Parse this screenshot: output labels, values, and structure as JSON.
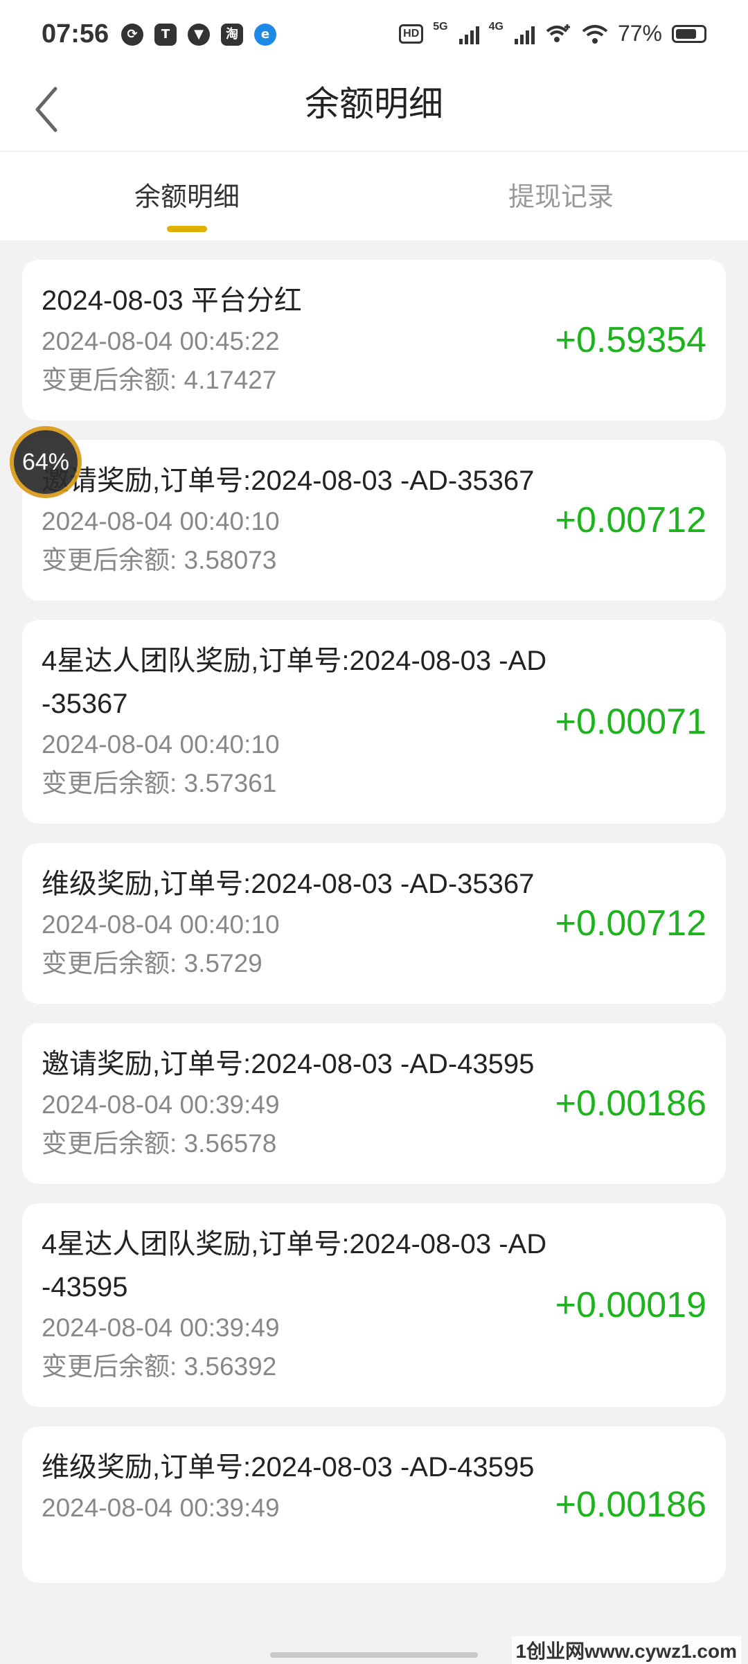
{
  "status_bar": {
    "time": "07:56",
    "app_icons": [
      "sync-icon",
      "shield-t-icon",
      "vpn-shield-icon",
      "taobao-icon",
      "browser-icon"
    ],
    "taobao_glyph": "淘",
    "hd_label": "HD",
    "net1": "5G",
    "net2": "4G",
    "battery_text": "77%",
    "battery_level": 0.77
  },
  "header": {
    "title": "余额明细",
    "back_icon": "chevron-left-icon"
  },
  "tabs": [
    {
      "label": "余额明细",
      "active": true
    },
    {
      "label": "提现记录",
      "active": false
    }
  ],
  "records": [
    {
      "title": "2024-08-03 平台分红",
      "time": "2024-08-04 00:45:22",
      "balance": "变更后余额: 4.17427",
      "amount": "+0.59354"
    },
    {
      "title": "邀请奖励,订单号:2024-08-03 -AD-35367",
      "time": "2024-08-04 00:40:10",
      "balance": "变更后余额: 3.58073",
      "amount": "+0.00712"
    },
    {
      "title": "4星达人团队奖励,订单号:2024-08-03 -AD-35367",
      "time": "2024-08-04 00:40:10",
      "balance": "变更后余额: 3.57361",
      "amount": "+0.00071"
    },
    {
      "title": "维级奖励,订单号:2024-08-03 -AD-35367",
      "time": "2024-08-04 00:40:10",
      "balance": "变更后余额: 3.5729",
      "amount": "+0.00712"
    },
    {
      "title": "邀请奖励,订单号:2024-08-03 -AD-43595",
      "time": "2024-08-04 00:39:49",
      "balance": "变更后余额: 3.56578",
      "amount": "+0.00186"
    },
    {
      "title": "4星达人团队奖励,订单号:2024-08-03 -AD-43595",
      "time": "2024-08-04 00:39:49",
      "balance": "变更后余额: 3.56392",
      "amount": "+0.00019"
    },
    {
      "title": "维级奖励,订单号:2024-08-03 -AD-43595",
      "time": "2024-08-04 00:39:49",
      "balance": "",
      "amount": "+0.00186"
    }
  ],
  "floating_badge": "64%",
  "watermark": "1创业网www.cywz1.com",
  "colors": {
    "accent": "#e0b000",
    "amount": "#1db31d",
    "background": "#f2f2f2"
  }
}
